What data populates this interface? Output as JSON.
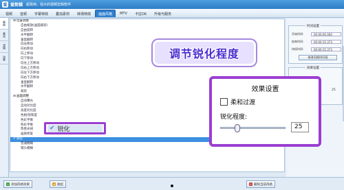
{
  "app": {
    "name": "爱剪辑",
    "slogan": "超易用、强大的视频剪辑软件",
    "logo": "爱"
  },
  "tabs": [
    {
      "label": "视频"
    },
    {
      "label": "音频"
    },
    {
      "label": "字幕特效"
    },
    {
      "label": "叠加素材"
    },
    {
      "label": "转场特效"
    },
    {
      "label": "画面风格",
      "active": true
    },
    {
      "label": "MTV"
    },
    {
      "label": "卡拉OK"
    },
    {
      "label": "升级与服务"
    }
  ],
  "side_tabs": [
    {
      "label": "画面",
      "active": true
    },
    {
      "label": "美化"
    },
    {
      "label": "滤镜"
    },
    {
      "label": "动景"
    }
  ],
  "list": [
    {
      "label": "位置调整",
      "group": true,
      "toggle": "⊟"
    },
    {
      "label": "自由缩放(画面裁剪)"
    },
    {
      "label": "自由旋转"
    },
    {
      "label": "水平翻转"
    },
    {
      "label": "垂直翻转"
    },
    {
      "label": "向左移动"
    },
    {
      "label": "向右移动"
    },
    {
      "label": "向上移动"
    },
    {
      "label": "向下移动"
    },
    {
      "label": "向左上方移动"
    },
    {
      "label": "向右上方移动"
    },
    {
      "label": "向左下方移动"
    },
    {
      "label": "向右下方移动"
    },
    {
      "label": "垂直翻转"
    },
    {
      "label": "水平翻转"
    },
    {
      "label": "裁剪"
    },
    {
      "label": "画面调整",
      "group": true,
      "toggle": "⊟"
    },
    {
      "label": "自动曝光"
    },
    {
      "label": "自动对比度"
    },
    {
      "label": "高度对比度"
    },
    {
      "label": "色相/饱和度"
    },
    {
      "label": "色彩平衡"
    },
    {
      "label": "色彩平衡"
    },
    {
      "label": "改善光线"
    },
    {
      "label": "画质修复"
    },
    {
      "label": "锐化",
      "selected": true,
      "check": true
    },
    {
      "label": "普通模糊"
    },
    {
      "label": "镜头模糊"
    }
  ],
  "banner_text": "调节锐化程度",
  "callout": {
    "title": "效果设置",
    "checkbox_label": "柔和过渡",
    "sharpen_label": "锐化程度:",
    "slider_value": "25",
    "slider_fraction": 0.25
  },
  "inline_callout": {
    "check": "✔",
    "label": "锐化"
  },
  "right_panel": {
    "time_title": "时间设置",
    "start_label": "开始时间:",
    "start_value": "00:00:00.000",
    "end_label": "结束时间:",
    "end_value": "00:00:15.373",
    "dur_label": "持续时间:",
    "dur_value": "00:00:15.373",
    "modify_button": "修改风格时间段",
    "effect_title": "效果设置",
    "effect_value": "25",
    "confirm_button": "确认修改"
  },
  "bottom": {
    "add_button": "添加风格效果",
    "add_icon": "+",
    "favorite_button": "收起",
    "favorite_icon": "★",
    "delete_button": "删除当前风格",
    "delete_icon": "✕"
  },
  "colors": {
    "accent": "#2f7fd0",
    "callout": "#9a3ed1",
    "banner_text": "#4a2ccf"
  }
}
